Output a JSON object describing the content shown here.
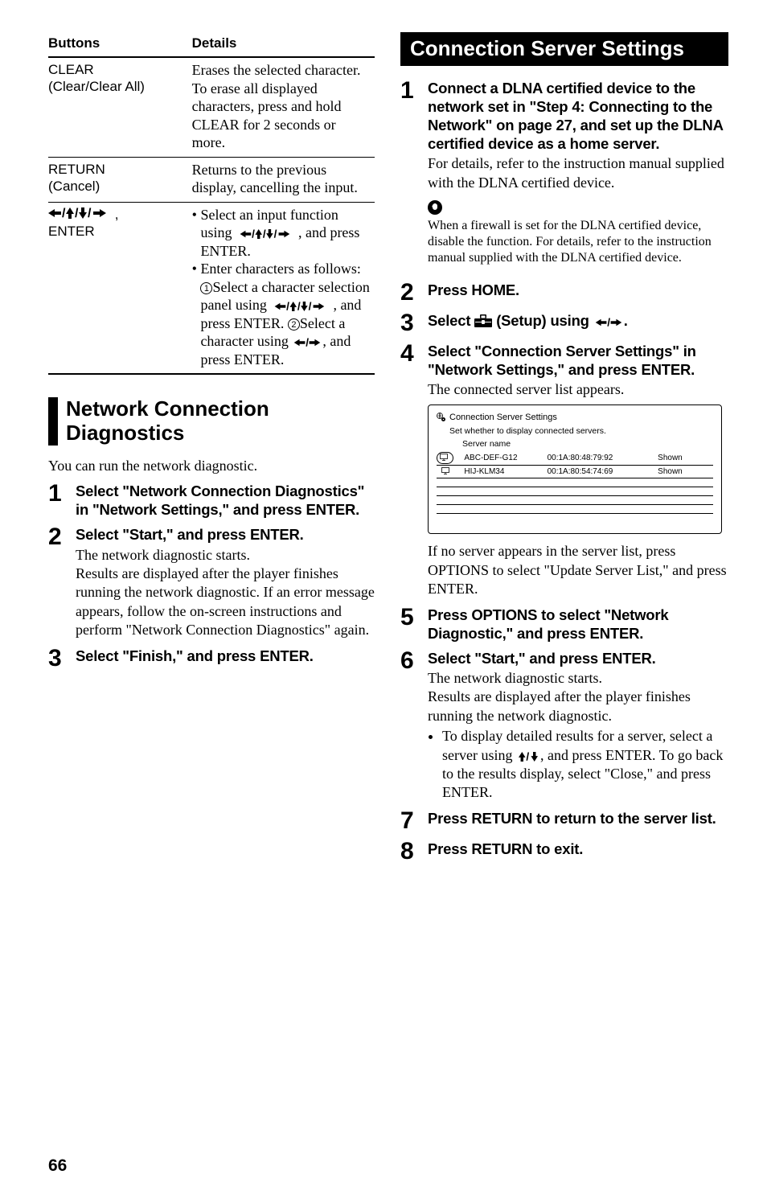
{
  "table": {
    "headers": [
      "Buttons",
      "Details"
    ],
    "rows": [
      {
        "button_line1": "CLEAR",
        "button_line2": "(Clear/Clear All)",
        "detail": "Erases the selected character.\nTo erase all displayed characters, press and hold CLEAR for 2 seconds or more."
      },
      {
        "button_line1": "RETURN",
        "button_line2": "(Cancel)",
        "detail": "Returns to the previous display, cancelling the input."
      },
      {
        "button_line1_html": "←/↑/↓/→,",
        "button_line2": "ENTER",
        "bullet1_pre": "Select an input function using ",
        "bullet1_post": ", and press ENTER.",
        "bullet2_pre": "Enter characters as follows: ",
        "bullet2_a": "Select a character selection panel using ",
        "bullet2_a_post": ", and press ENTER. ",
        "bullet2_b": "Select a character using ",
        "bullet2_b_post": ", and press ENTER."
      }
    ]
  },
  "left_section": {
    "heading_line1": "Network Connection",
    "heading_line2": "Diagnostics",
    "intro": "You can run the network diagnostic.",
    "steps": [
      {
        "num": "1",
        "title": "Select \"Network Connection Diagnostics\" in \"Network Settings,\" and press ENTER."
      },
      {
        "num": "2",
        "title": "Select \"Start,\" and press ENTER.",
        "text": "The network diagnostic starts.\nResults are displayed after the player finishes running the network diagnostic. If an error message appears, follow the on-screen instructions and perform \"Network Connection Diagnostics\" again."
      },
      {
        "num": "3",
        "title": "Select \"Finish,\" and press ENTER."
      }
    ]
  },
  "right_section": {
    "heading": "Connection Server Settings",
    "steps": {
      "1": {
        "num": "1",
        "title": "Connect a DLNA certified device to the network set in \"Step 4: Connecting to the Network\" on page 27, and set up the DLNA certified device as a home server.",
        "text": "For details, refer to the instruction manual supplied with the DLNA certified device.",
        "note": "When a firewall is set for the DLNA certified device, disable the function. For details, refer to the instruction manual supplied with the DLNA certified device."
      },
      "2": {
        "num": "2",
        "title": "Press HOME."
      },
      "3": {
        "num": "3",
        "title_pre": "Select ",
        "title_mid": " (Setup) using ",
        "title_post": "."
      },
      "4": {
        "num": "4",
        "title": "Select \"Connection Server Settings\" in \"Network Settings,\" and press ENTER.",
        "text": "The connected server list appears."
      },
      "4post": {
        "text": "If no server appears in the server list, press OPTIONS to select \"Update Server List,\" and press ENTER."
      },
      "5": {
        "num": "5",
        "title": "Press OPTIONS to select \"Network Diagnostic,\" and press ENTER."
      },
      "6": {
        "num": "6",
        "title": "Select \"Start,\" and press ENTER.",
        "text": "The network diagnostic starts.\nResults are displayed after the player finishes running the network diagnostic.",
        "bullet_pre": "To display detailed results for a server, select a server using ",
        "bullet_post": ", and press ENTER. To go back to the results display, select \"Close,\" and press ENTER."
      },
      "7": {
        "num": "7",
        "title": "Press RETURN to return to the server list."
      },
      "8": {
        "num": "8",
        "title": "Press RETURN to exit."
      }
    },
    "server_fig": {
      "title": "Connection Server Settings",
      "sub": "Set whether to display connected servers.",
      "col": "Server name",
      "rows": [
        {
          "name": "ABC-DEF-G12",
          "mac": "00:1A:80:48:79:92",
          "status": "Shown"
        },
        {
          "name": "HIJ-KLM34",
          "mac": "00:1A:80:54:74:69",
          "status": "Shown"
        }
      ]
    }
  },
  "page_number": "66"
}
